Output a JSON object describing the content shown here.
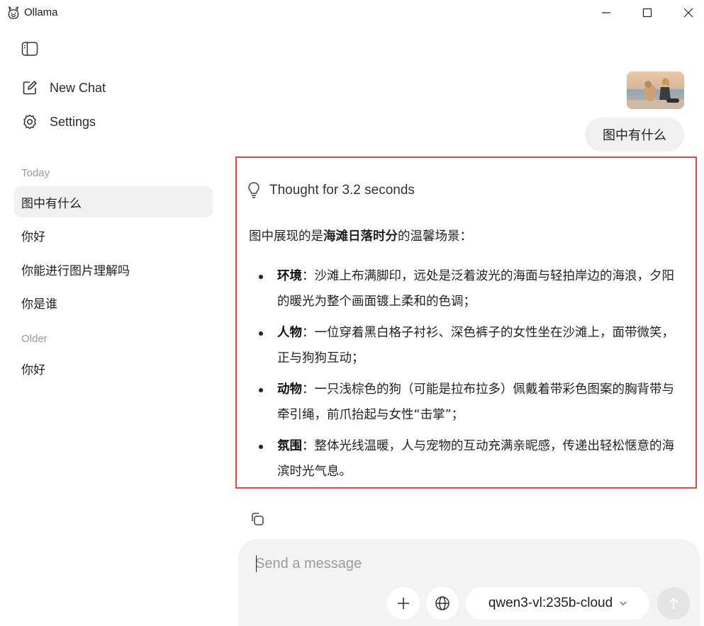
{
  "window": {
    "title": "Ollama",
    "icons": {
      "app": "ollama-llama-icon",
      "minimize": "minimize-icon",
      "maximize": "maximize-icon",
      "close": "close-icon"
    }
  },
  "sidebar": {
    "toggle_icon": "sidebar-toggle-icon",
    "nav": [
      {
        "label": "New Chat",
        "icon": "edit-icon"
      },
      {
        "label": "Settings",
        "icon": "gear-icon"
      }
    ],
    "sections": [
      {
        "label": "Today",
        "chats": [
          "图中有什么",
          "你好",
          "你能进行图片理解吗",
          "你是谁"
        ]
      },
      {
        "label": "Older",
        "chats": [
          "你好"
        ]
      }
    ],
    "active_chat": "图中有什么"
  },
  "conversation": {
    "user": {
      "attachment": "beach-photo-thumbnail",
      "text": "图中有什么"
    },
    "assistant": {
      "thought": "Thought for 3.2 seconds",
      "intro_prefix": "图中展现的是",
      "intro_bold": "海滩日落时分",
      "intro_suffix": "的温馨场景：",
      "bullets": [
        {
          "term": "环境",
          "text": "：沙滩上布满脚印，远处是泛着波光的海面与轻拍岸边的海浪，夕阳的暖光为整个画面镀上柔和的色调；"
        },
        {
          "term": "人物",
          "text": "：一位穿着黑白格子衬衫、深色裤子的女性坐在沙滩上，面带微笑，正与狗狗互动；"
        },
        {
          "term": "动物",
          "text": "：一只浅棕色的狗（可能是拉布拉多）佩戴着带彩色图案的胸背带与牵引绳，前爪抬起与女性“击掌”；"
        },
        {
          "term": "氛围",
          "text": "：整体光线温暖，人与宠物的互动充满亲昵感，传递出轻松惬意的海滨时光气息。"
        }
      ],
      "highlight_color": "#e0454a"
    }
  },
  "composer": {
    "placeholder": "Send a message",
    "value": "",
    "model": "qwen3-vl:235b-cloud",
    "icons": {
      "add": "plus-icon",
      "web": "globe-icon",
      "dropdown": "chevron-down-icon",
      "send": "arrow-up-icon",
      "copy": "copy-icon"
    }
  }
}
